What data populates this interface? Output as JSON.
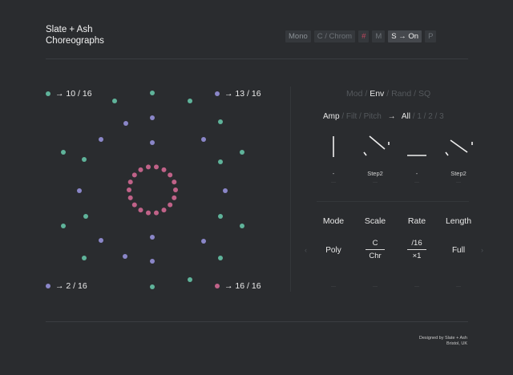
{
  "brand": {
    "line1": "Slate + Ash",
    "line2": "Choreographs"
  },
  "toolbar": [
    {
      "label": "Mono",
      "state": "muted-hi"
    },
    {
      "label": "C / Chrom",
      "state": "muted"
    },
    {
      "label": "#",
      "state": "red"
    },
    {
      "label": "M",
      "state": "muted"
    },
    {
      "label": "S → On",
      "state": "on"
    },
    {
      "label": "P",
      "state": "muted"
    }
  ],
  "corners": {
    "top_left": {
      "label": "→ 10 / 16",
      "color": "#5fb39a"
    },
    "top_right": {
      "label": "→ 13 / 16",
      "color": "#8a86c8"
    },
    "bottom_left": {
      "label": "→ 2 / 16",
      "color": "#8a86c8"
    },
    "bottom_right": {
      "label": "→ 16 / 16",
      "color": "#c06288"
    }
  },
  "colors": {
    "teal": "#5fb39a",
    "purple": "#8a86c8",
    "pink": "#c06288",
    "background": "#2a2c2f"
  },
  "tabs": {
    "mod": "Mod",
    "env": "Env",
    "rand": "Rand",
    "sq": "SQ",
    "sep": " / "
  },
  "targets": {
    "amp": "Amp",
    "filt": "Filt",
    "pitch": "Pitch",
    "arrow": "→",
    "all": "All",
    "one": "1",
    "two": "2",
    "three": "3",
    "sep": " / "
  },
  "envelopes": [
    {
      "icon": "env-gate",
      "label": "-",
      "sub": "---"
    },
    {
      "icon": "env-step",
      "label": "Step2",
      "sub": "---"
    },
    {
      "icon": "env-flat",
      "label": "-",
      "sub": "---"
    },
    {
      "icon": "env-step",
      "label": "Step2",
      "sub": "---"
    }
  ],
  "params": {
    "headers": [
      "Mode",
      "Scale",
      "Rate",
      "Length"
    ],
    "mode": "Poly",
    "scale": {
      "top": "C",
      "bottom": "Chr"
    },
    "rate": {
      "top": "/16",
      "bottom": "×1"
    },
    "length": "Full",
    "footer": [
      "---",
      "---",
      "---",
      "---"
    ]
  },
  "nav": {
    "prev": "‹",
    "next": "›"
  },
  "credits": {
    "line1": "Designed by Slate + Ash",
    "line2": "Bristol, UK"
  }
}
